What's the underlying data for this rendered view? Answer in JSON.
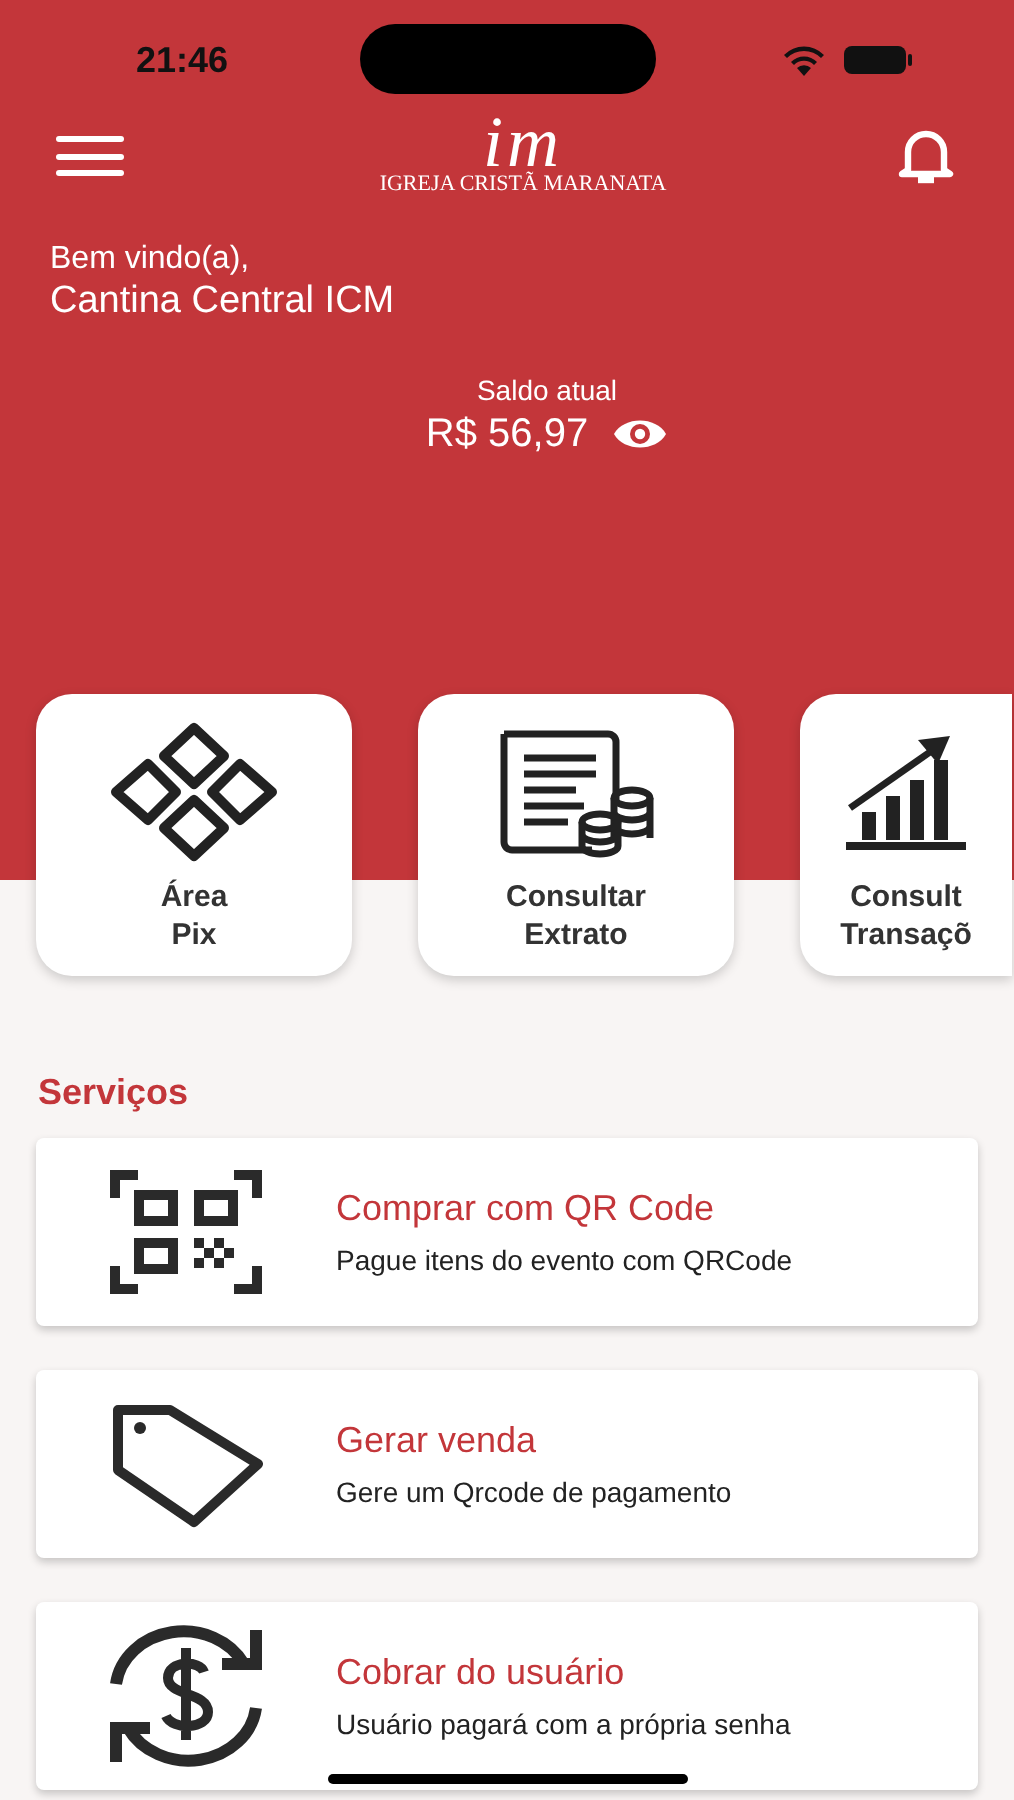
{
  "status_bar": {
    "time": "21:46"
  },
  "header": {
    "logo": {
      "mark": "im",
      "name": "IGREJA CRISTÃ MARANATA"
    }
  },
  "greeting": {
    "label": "Bem vindo(a),",
    "name": "Cantina Central ICM"
  },
  "balance": {
    "label": "Saldo atual",
    "value": "R$ 56,97"
  },
  "shortcuts": [
    {
      "kind": "pix",
      "lines": [
        "Área",
        "Pix"
      ]
    },
    {
      "kind": "statement",
      "lines": [
        "Consultar",
        "Extrato"
      ]
    },
    {
      "kind": "chart",
      "lines": [
        "Consult",
        "Transaçõ"
      ]
    }
  ],
  "services_title": "Serviços",
  "services": [
    {
      "kind": "qr",
      "title": "Comprar com QR Code",
      "subtitle": "Pague itens do evento com QRCode"
    },
    {
      "kind": "tag",
      "title": "Gerar venda",
      "subtitle": "Gere um Qrcode de pagamento"
    },
    {
      "kind": "charge",
      "title": "Cobrar do usuário",
      "subtitle": "Usuário pagará com a própria senha"
    }
  ]
}
